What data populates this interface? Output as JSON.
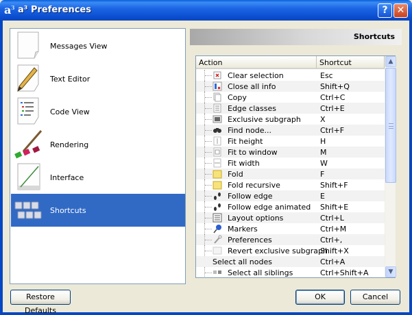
{
  "window": {
    "title": "a³ Preferences",
    "help_glyph": "?",
    "close_glyph": "✕"
  },
  "nav": {
    "items": [
      {
        "label": "Messages View",
        "icon": "document-icon",
        "selected": false
      },
      {
        "label": "Text Editor",
        "icon": "pencil-paper-icon",
        "selected": false
      },
      {
        "label": "Code View",
        "icon": "code-list-icon",
        "selected": false
      },
      {
        "label": "Rendering",
        "icon": "paintbrush-icon",
        "selected": false
      },
      {
        "label": "Interface",
        "icon": "interface-icon",
        "selected": false
      },
      {
        "label": "Shortcuts",
        "icon": "keyboard-icon",
        "selected": true
      }
    ]
  },
  "panel": {
    "title": "Shortcuts",
    "columns": {
      "action": "Action",
      "shortcut": "Shortcut"
    },
    "rows": [
      {
        "action": "Clear selection",
        "shortcut": "Esc",
        "icon": "clear-icon"
      },
      {
        "action": "Close all info",
        "shortcut": "Shift+Q",
        "icon": "close-info-icon"
      },
      {
        "action": "Copy",
        "shortcut": "Ctrl+C",
        "icon": "copy-icon"
      },
      {
        "action": "Edge classes",
        "shortcut": "Ctrl+E",
        "icon": "edge-classes-icon"
      },
      {
        "action": "Exclusive subgraph",
        "shortcut": "X",
        "icon": "subgraph-icon"
      },
      {
        "action": "Find node...",
        "shortcut": "Ctrl+F",
        "icon": "binoculars-icon"
      },
      {
        "action": "Fit height",
        "shortcut": "H",
        "icon": "fit-height-icon"
      },
      {
        "action": "Fit to window",
        "shortcut": "M",
        "icon": "fit-window-icon"
      },
      {
        "action": "Fit width",
        "shortcut": "W",
        "icon": "fit-width-icon"
      },
      {
        "action": "Fold",
        "shortcut": "F",
        "icon": "fold-icon"
      },
      {
        "action": "Fold recursive",
        "shortcut": "Shift+F",
        "icon": "fold-recursive-icon"
      },
      {
        "action": "Follow edge",
        "shortcut": "E",
        "icon": "footprints-icon"
      },
      {
        "action": "Follow edge animated",
        "shortcut": "Shift+E",
        "icon": "footprints-animated-icon"
      },
      {
        "action": "Layout options",
        "shortcut": "Ctrl+L",
        "icon": "layout-icon"
      },
      {
        "action": "Markers",
        "shortcut": "Ctrl+M",
        "icon": "pin-icon"
      },
      {
        "action": "Preferences",
        "shortcut": "Ctrl+,",
        "icon": "wrench-icon"
      },
      {
        "action": "Revert exclusive subgraph",
        "shortcut": "Shift+X",
        "icon": "revert-icon"
      },
      {
        "action": "Select all nodes",
        "shortcut": "Ctrl+A",
        "icon": "",
        "top_level": true
      },
      {
        "action": "Select all siblings",
        "shortcut": "Ctrl+Shift+A",
        "icon": "siblings-icon"
      }
    ]
  },
  "buttons": {
    "restore": "Restore Defaults",
    "ok": "OK",
    "cancel": "Cancel"
  },
  "scrollbar": {
    "up_glyph": "▲",
    "down_glyph": "▼"
  }
}
